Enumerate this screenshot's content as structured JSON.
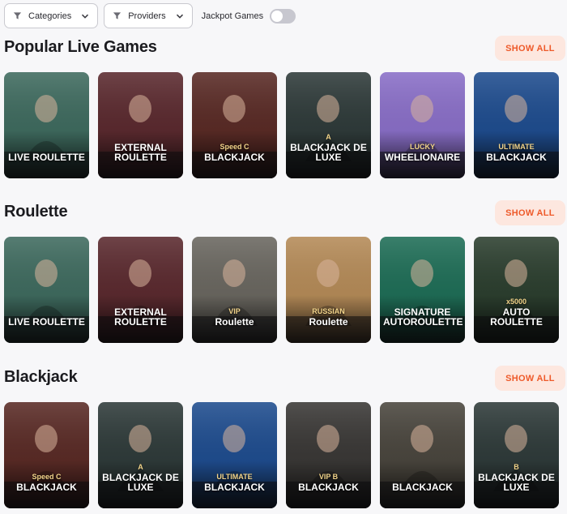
{
  "filters": {
    "categories_label": "Categories",
    "providers_label": "Providers",
    "jackpot_label": "Jackpot Games"
  },
  "sections": [
    {
      "title": "Popular Live Games",
      "show_all": "SHOW ALL",
      "cards": [
        {
          "label": "LIVE ROULETTE",
          "sub": "",
          "bg": "#3f6b5f"
        },
        {
          "label": "EXTERNAL ROULETTE",
          "sub": "",
          "bg": "#5b2a2f"
        },
        {
          "label": "BLACKJACK",
          "sub": "Speed C",
          "bg": "#5a2b26"
        },
        {
          "label": "BLACKJACK DE LUXE",
          "sub": "A",
          "bg": "#2f3b3a"
        },
        {
          "label": "WHEELIONAIRE",
          "sub": "LUCKY",
          "bg": "#8a6fc8"
        },
        {
          "label": "BLACKJACK",
          "sub": "ULTIMATE",
          "bg": "#1f4d8f"
        }
      ]
    },
    {
      "title": "Roulette",
      "show_all": "SHOW ALL",
      "cards": [
        {
          "label": "LIVE ROULETTE",
          "sub": "",
          "bg": "#3f6b5f"
        },
        {
          "label": "EXTERNAL ROULETTE",
          "sub": "",
          "bg": "#5b2a2f"
        },
        {
          "label": "Roulette",
          "sub": "VIP",
          "bg": "#6a6760"
        },
        {
          "label": "Roulette",
          "sub": "RUSSIAN",
          "bg": "#b58b58"
        },
        {
          "label": "SIGNATURE AUTOROULETTE",
          "sub": "",
          "bg": "#1f6e57"
        },
        {
          "label": "AUTO ROULETTE",
          "sub": "x5000",
          "bg": "#2c3f2f"
        }
      ]
    },
    {
      "title": "Blackjack",
      "show_all": "SHOW ALL",
      "cards": [
        {
          "label": "BLACKJACK",
          "sub": "Speed C",
          "bg": "#5a2b26"
        },
        {
          "label": "BLACKJACK DE LUXE",
          "sub": "A",
          "bg": "#2f3b3a"
        },
        {
          "label": "BLACKJACK",
          "sub": "ULTIMATE",
          "bg": "#1f4d8f"
        },
        {
          "label": "BLACKJACK",
          "sub": "VIP B",
          "bg": "#3a3836"
        },
        {
          "label": "BLACKJACK",
          "sub": "",
          "bg": "#4a463e"
        },
        {
          "label": "BLACKJACK DE LUXE",
          "sub": "B",
          "bg": "#2f3b3a"
        }
      ]
    }
  ],
  "colors": {
    "accent": "#ee5a2a",
    "accent_bg": "#fde7df",
    "page_bg": "#f7f7f9"
  }
}
